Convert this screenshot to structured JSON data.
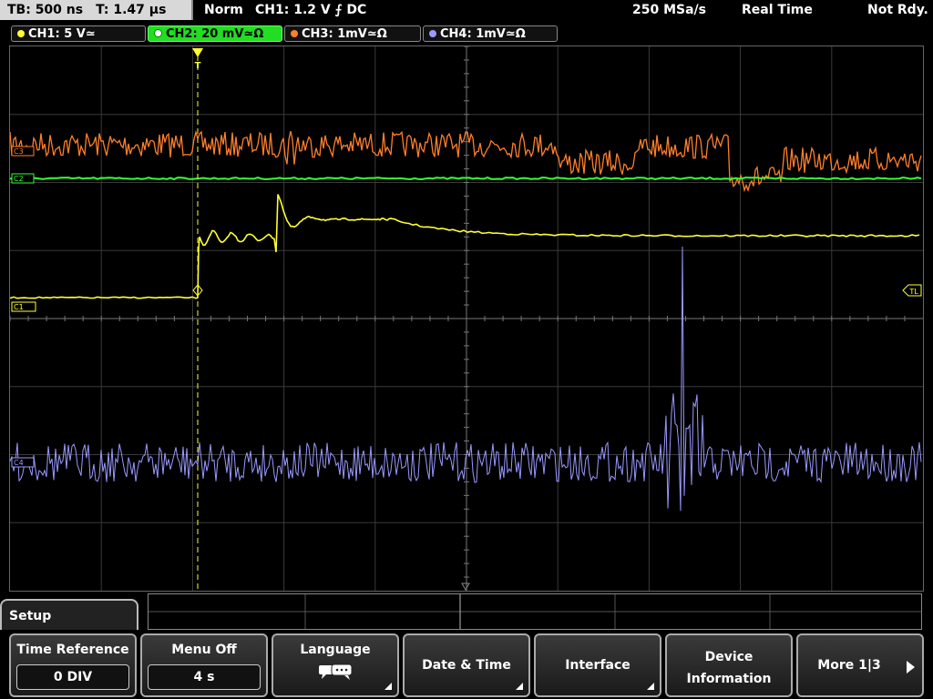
{
  "top_bar": {
    "timebase": "TB: 500 ns",
    "trigger_time": "T: 1.47 µs",
    "mode": "Norm",
    "trigger_info": "CH1: 1.2 V ⨍ DC",
    "sample_rate": "250 MSa/s",
    "acq_mode": "Real Time",
    "status": "Not Rdy."
  },
  "channels": [
    {
      "label": "CH1: 5 V≃",
      "color": "#ffff33",
      "active": false
    },
    {
      "label": "CH2: 20 mV≃Ω",
      "color": "#33ff33",
      "active": true
    },
    {
      "label": "CH3: 1mV≃Ω",
      "color": "#ff7f2a",
      "active": false
    },
    {
      "label": "CH4: 1mV≃Ω",
      "color": "#9999ff",
      "active": false
    }
  ],
  "markers": {
    "c1": "C1",
    "c2": "C2",
    "c3": "C3",
    "c4": "C4",
    "trigger_level": "TL",
    "trigger_pos": "T"
  },
  "menu": {
    "title": "Setup",
    "softkeys": [
      {
        "label": "Time Reference",
        "value": "0 DIV"
      },
      {
        "label": "Menu Off",
        "value": "4 s"
      },
      {
        "label": "Language",
        "icon": "speech-bubble-icon"
      },
      {
        "label": "Date & Time"
      },
      {
        "label": "Interface"
      },
      {
        "label1": "Device",
        "label2": "Information"
      },
      {
        "label": "More 1|3"
      }
    ]
  }
}
